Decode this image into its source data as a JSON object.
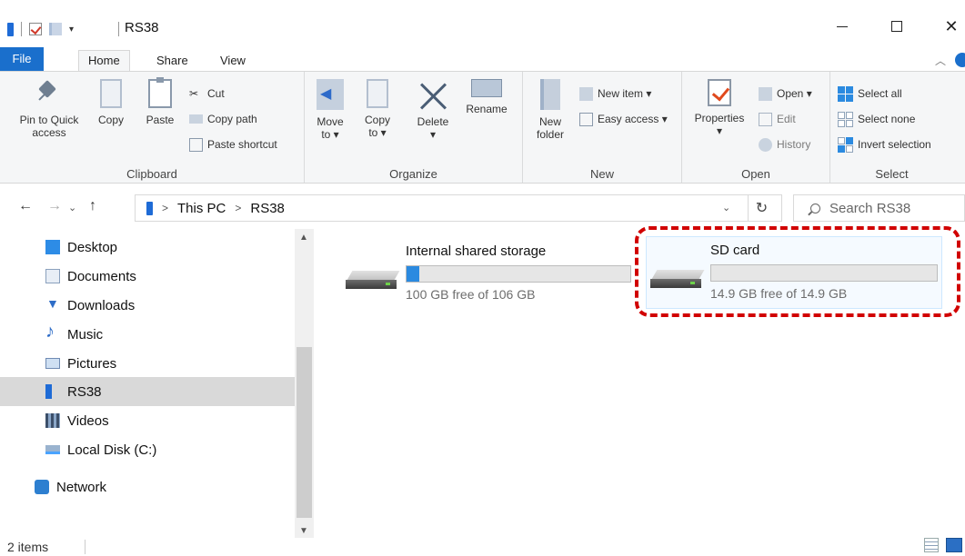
{
  "window": {
    "title": "RS38",
    "tabs": [
      "File",
      "Home",
      "Share",
      "View"
    ]
  },
  "ribbon": {
    "clipboard": {
      "pin_label_1": "Pin to Quick",
      "pin_label_2": "access",
      "copy": "Copy",
      "paste": "Paste",
      "cut": "Cut",
      "copy_path": "Copy path",
      "paste_shortcut": "Paste shortcut",
      "group": "Clipboard"
    },
    "organize": {
      "move_to_1": "Move",
      "move_to_2": "to ▾",
      "copy_to_1": "Copy",
      "copy_to_2": "to ▾",
      "delete": "Delete",
      "delete_arrow": "▾",
      "rename": "Rename",
      "group": "Organize"
    },
    "new": {
      "new_folder_1": "New",
      "new_folder_2": "folder",
      "new_item": "New item ▾",
      "easy_access": "Easy access ▾",
      "group": "New"
    },
    "open": {
      "properties": "Properties",
      "properties_arrow": "▾",
      "open": "Open ▾",
      "edit": "Edit",
      "history": "History",
      "group": "Open"
    },
    "select": {
      "select_all": "Select all",
      "select_none": "Select none",
      "invert": "Invert selection",
      "group": "Select"
    }
  },
  "address": {
    "root": "This PC",
    "current": "RS38",
    "separator": ">",
    "search_placeholder": "Search RS38"
  },
  "nav_pane": {
    "items": [
      {
        "label": "Desktop"
      },
      {
        "label": "Documents"
      },
      {
        "label": "Downloads"
      },
      {
        "label": "Music"
      },
      {
        "label": "Pictures"
      },
      {
        "label": "RS38"
      },
      {
        "label": "Videos"
      },
      {
        "label": "Local Disk (C:)"
      },
      {
        "label": "Network"
      }
    ]
  },
  "drives": [
    {
      "name": "Internal shared storage",
      "free": "100 GB free of 106 GB",
      "used_fraction": 0.057
    },
    {
      "name": "SD card",
      "free": "14.9 GB free of 14.9 GB",
      "used_fraction": 0.0
    }
  ],
  "status": {
    "count": "2 items"
  },
  "colors": {
    "accent": "#1a6fcc",
    "highlight": "#d10000",
    "bar_fill": "#2b8ae0"
  }
}
